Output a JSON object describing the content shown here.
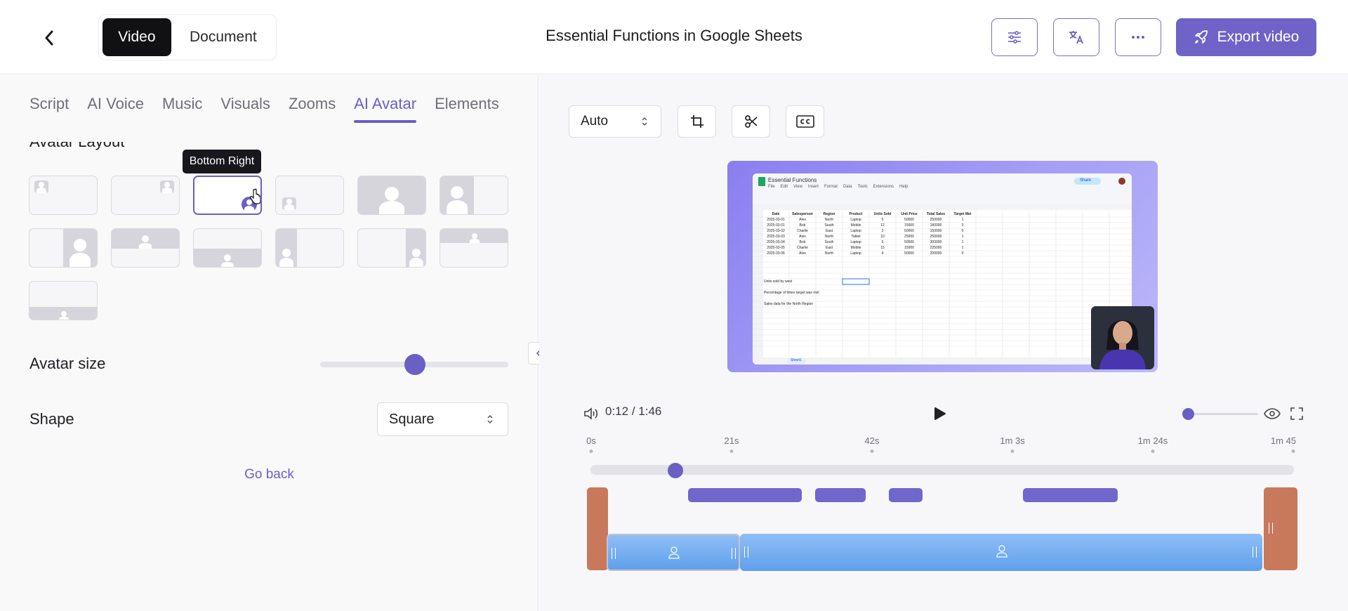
{
  "header": {
    "mode_tabs": [
      "Video",
      "Document"
    ],
    "title": "Essential Functions in Google Sheets",
    "export_label": "Export video"
  },
  "left": {
    "tabs": [
      "Script",
      "AI Voice",
      "Music",
      "Visuals",
      "Zooms",
      "AI Avatar",
      "Elements"
    ],
    "active_tab": "AI Avatar",
    "section_title": "Avatar Layout",
    "tooltip": "Bottom Right",
    "avatar_size_label": "Avatar size",
    "avatar_size_value": 0.5,
    "shape_label": "Shape",
    "shape_value": "Square",
    "go_back": "Go back"
  },
  "right": {
    "aspect_value": "Auto",
    "time_current": "0:12",
    "time_sep": " / ",
    "time_total": "1:46",
    "ruler_labels": [
      "0s",
      "21s",
      "42s",
      "1m 3s",
      "1m 24s",
      "1m 45"
    ]
  },
  "sheet": {
    "doc_title": "Essential Functions",
    "menu": [
      "File",
      "Edit",
      "View",
      "Insert",
      "Format",
      "Data",
      "Tools",
      "Extensions",
      "Help"
    ],
    "headers": [
      "Date",
      "Salesperson",
      "Region",
      "Product",
      "Units Sold",
      "Unit Price",
      "Total Sales",
      "Target Met"
    ],
    "rows": [
      [
        "2025-03-01",
        "Alex",
        "North",
        "Laptop",
        "5",
        "50000",
        "250000",
        "1"
      ],
      [
        "2025-03-01",
        "Bob",
        "South",
        "Mobile",
        "12",
        "15000",
        "180000",
        "0"
      ],
      [
        "2025-03-02",
        "Charlie",
        "East",
        "Laptop",
        "3",
        "50000",
        "150000",
        "0"
      ],
      [
        "2025-03-03",
        "Alex",
        "North",
        "Tablet",
        "10",
        "25000",
        "250000",
        "1"
      ],
      [
        "2025-03-04",
        "Bob",
        "South",
        "Laptop",
        "6",
        "50000",
        "300000",
        "1"
      ],
      [
        "2025-03-05",
        "Charlie",
        "East",
        "Mobile",
        "15",
        "15000",
        "225000",
        "1"
      ],
      [
        "2025-03-06",
        "Alex",
        "North",
        "Laptop",
        "4",
        "50000",
        "200000",
        "0"
      ]
    ],
    "notes": [
      "Units sold by west",
      "Percentage of times target was met",
      "Sales data for the North Region"
    ],
    "sheet_tab": "Sheet1",
    "share_label": "Share"
  },
  "colors": {
    "accent": "#6b5fc4",
    "export": "#6f63c8",
    "clip": "#7066cc",
    "edge": "#c8785b",
    "track": "#6aa8ef"
  }
}
